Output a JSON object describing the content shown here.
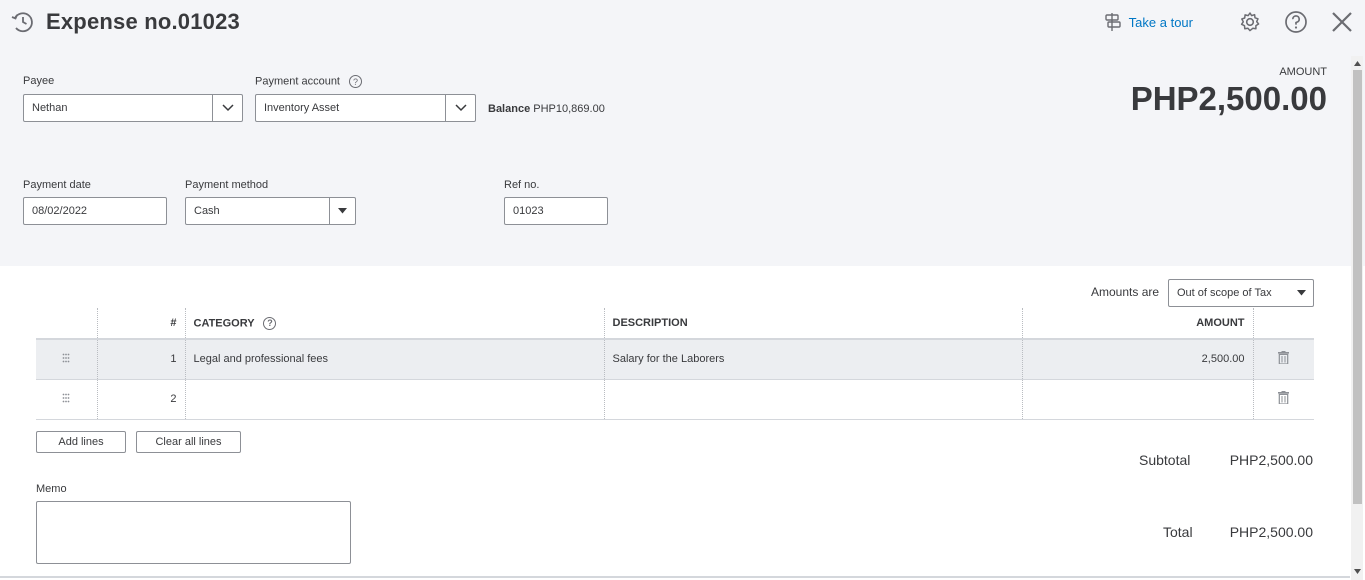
{
  "header": {
    "title": "Expense no.01023",
    "tour_label": "Take a tour"
  },
  "payee": {
    "label": "Payee",
    "value": "Nethan"
  },
  "payment_account": {
    "label": "Payment account",
    "value": "Inventory Asset"
  },
  "balance": {
    "label": "Balance",
    "value": "PHP10,869.00"
  },
  "amount": {
    "label": "AMOUNT",
    "value": "PHP2,500.00"
  },
  "payment_date": {
    "label": "Payment date",
    "value": "08/02/2022"
  },
  "payment_method": {
    "label": "Payment method",
    "value": "Cash"
  },
  "ref_no": {
    "label": "Ref no.",
    "value": "01023"
  },
  "amounts_are": {
    "label": "Amounts are",
    "value": "Out of scope of Tax"
  },
  "table": {
    "headers": {
      "num": "#",
      "category": "CATEGORY",
      "description": "DESCRIPTION",
      "amount": "AMOUNT"
    },
    "rows": [
      {
        "num": "1",
        "category": "Legal and professional fees",
        "description": "Salary for the Laborers",
        "amount": "2,500.00"
      },
      {
        "num": "2",
        "category": "",
        "description": "",
        "amount": ""
      }
    ]
  },
  "buttons": {
    "add_lines": "Add lines",
    "clear_all_lines": "Clear all lines"
  },
  "memo": {
    "label": "Memo",
    "value": ""
  },
  "totals": {
    "subtotal_label": "Subtotal",
    "subtotal_value": "PHP2,500.00",
    "total_label": "Total",
    "total_value": "PHP2,500.00"
  },
  "colors": {
    "link": "#0077c5",
    "header_bg": "#f4f5f8",
    "row_highlight": "#eceef1"
  }
}
